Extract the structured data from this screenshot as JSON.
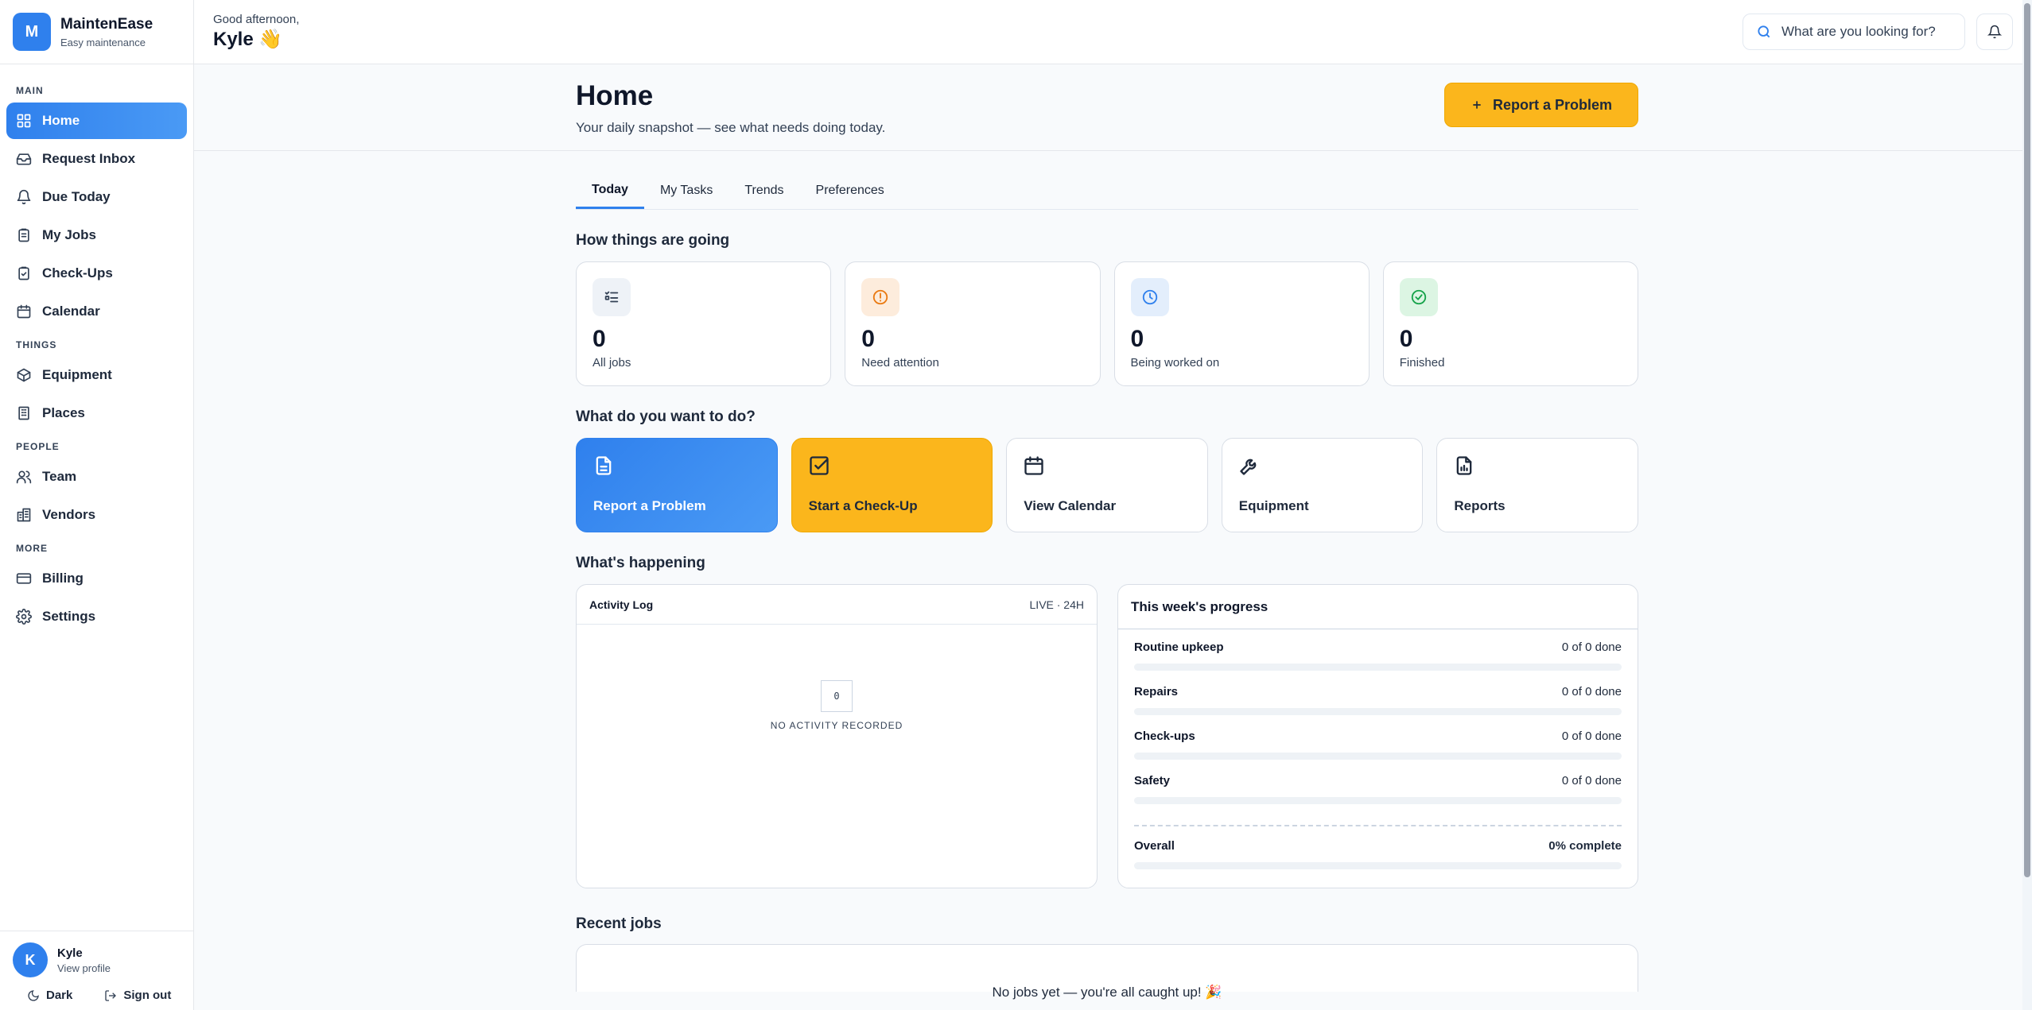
{
  "brand": {
    "initial": "M",
    "name": "MaintenEase",
    "tagline": "Easy maintenance"
  },
  "sidebar": {
    "sections": [
      {
        "title": "MAIN",
        "items": [
          {
            "label": "Home",
            "icon": "grid-icon",
            "active": true
          },
          {
            "label": "Request Inbox",
            "icon": "inbox-icon"
          },
          {
            "label": "Due Today",
            "icon": "bell-icon"
          },
          {
            "label": "My Jobs",
            "icon": "clipboard-icon"
          },
          {
            "label": "Check-Ups",
            "icon": "clipboard-check-icon"
          },
          {
            "label": "Calendar",
            "icon": "calendar-icon"
          }
        ]
      },
      {
        "title": "THINGS",
        "items": [
          {
            "label": "Equipment",
            "icon": "box-icon"
          },
          {
            "label": "Places",
            "icon": "building-icon"
          }
        ]
      },
      {
        "title": "PEOPLE",
        "items": [
          {
            "label": "Team",
            "icon": "users-icon"
          },
          {
            "label": "Vendors",
            "icon": "vendor-icon"
          }
        ]
      },
      {
        "title": "MORE",
        "items": [
          {
            "label": "Billing",
            "icon": "credit-card-icon"
          },
          {
            "label": "Settings",
            "icon": "gear-icon"
          }
        ]
      }
    ]
  },
  "profile": {
    "initial": "K",
    "name": "Kyle",
    "sub": "View profile",
    "dark_label": "Dark",
    "signout_label": "Sign out"
  },
  "topbar": {
    "greeting": "Good afternoon,",
    "name": "Kyle 👋",
    "search_placeholder": "What are you looking for?"
  },
  "page": {
    "title": "Home",
    "subtitle": "Your daily snapshot — see what needs doing today.",
    "report_button": "Report a Problem"
  },
  "tabs": [
    {
      "label": "Today",
      "active": true
    },
    {
      "label": "My Tasks"
    },
    {
      "label": "Trends"
    },
    {
      "label": "Preferences"
    }
  ],
  "stats_title": "How things are going",
  "stats": [
    {
      "value": "0",
      "label": "All jobs",
      "icon": "list-check-icon",
      "bg": "#eef2f7",
      "fg": "#334155"
    },
    {
      "value": "0",
      "label": "Need attention",
      "icon": "alert-circle-icon",
      "bg": "#fdecdc",
      "fg": "#ea7a12"
    },
    {
      "value": "0",
      "label": "Being worked on",
      "icon": "clock-icon",
      "bg": "#e3eefc",
      "fg": "#2f80ed"
    },
    {
      "value": "0",
      "label": "Finished",
      "icon": "check-circle-icon",
      "bg": "#dcf5e3",
      "fg": "#16a34a"
    }
  ],
  "actions_title": "What do you want to do?",
  "actions": [
    {
      "label": "Report a Problem",
      "icon": "document-icon",
      "style": "blue"
    },
    {
      "label": "Start a Check-Up",
      "icon": "checkbox-icon",
      "style": "yellow"
    },
    {
      "label": "View Calendar",
      "icon": "calendar-icon",
      "style": "plain"
    },
    {
      "label": "Equipment",
      "icon": "wrench-icon",
      "style": "plain"
    },
    {
      "label": "Reports",
      "icon": "report-icon",
      "style": "plain"
    }
  ],
  "happening_title": "What's happening",
  "activity": {
    "title": "Activity Log",
    "live": "LIVE · 24H",
    "count": "0",
    "empty": "NO ACTIVITY RECORDED"
  },
  "progress": {
    "title": "This week's progress",
    "rows": [
      {
        "name": "Routine upkeep",
        "value": "0 of 0 done",
        "pct": 0
      },
      {
        "name": "Repairs",
        "value": "0 of 0 done",
        "pct": 0
      },
      {
        "name": "Check-ups",
        "value": "0 of 0 done",
        "pct": 0
      },
      {
        "name": "Safety",
        "value": "0 of 0 done",
        "pct": 0
      }
    ],
    "overall": {
      "name": "Overall",
      "value": "0% complete",
      "pct": 0
    }
  },
  "recent": {
    "title": "Recent jobs",
    "empty": "No jobs yet — you're all caught up! 🎉"
  }
}
